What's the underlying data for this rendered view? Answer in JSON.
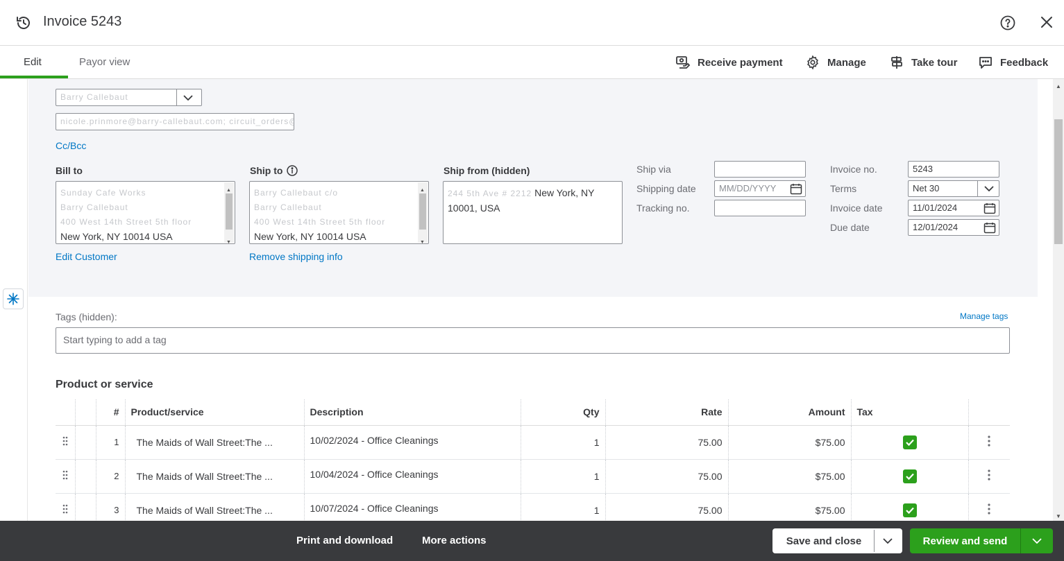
{
  "header": {
    "title": "Invoice 5243",
    "icons": {
      "history": "history-icon",
      "help": "help-icon",
      "close": "close-icon"
    }
  },
  "tabs": [
    {
      "label": "Edit",
      "active": true
    },
    {
      "label": "Payor view",
      "active": false
    }
  ],
  "toolbar": {
    "receive_payment": "Receive payment",
    "manage": "Manage",
    "take_tour": "Take tour",
    "feedback": "Feedback"
  },
  "customer": {
    "name_value": "Barry Callebaut",
    "email_value": "nicole.prinmore@barry-callebaut.com; circuit_orders@",
    "cc_bcc": "Cc/Bcc"
  },
  "bill_to": {
    "label": "Bill to",
    "lines": [
      "Sunday Cafe Works",
      "Barry Callebaut",
      "400 West 14th Street 5th floor",
      "New York, NY  10014 USA"
    ],
    "edit_link": "Edit Customer"
  },
  "ship_to": {
    "label": "Ship to",
    "lines": [
      "Barry Callebaut c/o",
      "Barry Callebaut",
      "400 West 14th Street 5th floor",
      "New York, NY  10014 USA"
    ],
    "remove_link": "Remove shipping info"
  },
  "ship_from": {
    "label": "Ship from (hidden)",
    "blur_part": "244 5th Ave # 2212",
    "visible_part": "New York, NY",
    "line2": "10001, USA"
  },
  "shipping": {
    "ship_via_label": "Ship via",
    "ship_via_value": "",
    "shipping_date_label": "Shipping date",
    "shipping_date_placeholder": "MM/DD/YYYY",
    "tracking_label": "Tracking no.",
    "tracking_value": ""
  },
  "invoice_meta": {
    "invoice_no_label": "Invoice no.",
    "invoice_no_value": "5243",
    "terms_label": "Terms",
    "terms_value": "Net 30",
    "invoice_date_label": "Invoice date",
    "invoice_date_value": "11/01/2024",
    "due_date_label": "Due date",
    "due_date_value": "12/01/2024"
  },
  "tags": {
    "label": "Tags (hidden):",
    "manage": "Manage tags",
    "placeholder": "Start typing to add a tag"
  },
  "products": {
    "section_title": "Product or service",
    "columns": [
      "#",
      "Product/service",
      "Description",
      "Qty",
      "Rate",
      "Amount",
      "Tax"
    ],
    "rows": [
      {
        "num": "1",
        "product": "The Maids of Wall Street:The ...",
        "description": "10/02/2024 - Office Cleanings",
        "qty": "1",
        "rate": "75.00",
        "amount": "$75.00",
        "tax": true
      },
      {
        "num": "2",
        "product": "The Maids of Wall Street:The ...",
        "description": "10/04/2024 - Office Cleanings",
        "qty": "1",
        "rate": "75.00",
        "amount": "$75.00",
        "tax": true
      },
      {
        "num": "3",
        "product": "The Maids of Wall Street:The ...",
        "description": "10/07/2024 - Office Cleanings",
        "qty": "1",
        "rate": "75.00",
        "amount": "$75.00",
        "tax": true
      }
    ]
  },
  "footer": {
    "print_download": "Print and download",
    "more_actions": "More actions",
    "save_close": "Save and close",
    "review_send": "Review and send"
  },
  "colors": {
    "accent": "#2ca01c",
    "link": "#0077c5",
    "footer": "#393a3d",
    "panel": "#f4f5f8"
  }
}
